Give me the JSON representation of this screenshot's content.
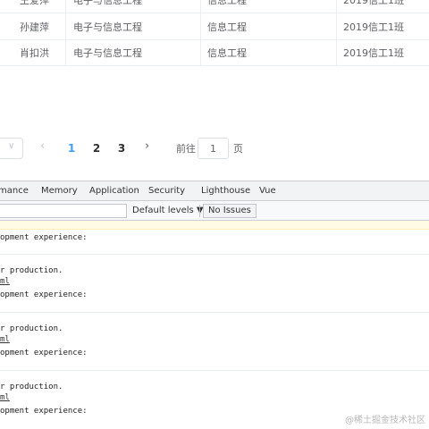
{
  "table": {
    "rows": [
      {
        "name": "王爱萍",
        "major": "电子与信息工程",
        "dept": "信息工程",
        "class": "2019信工1班"
      },
      {
        "name": "孙建萍",
        "major": "电子与信息工程",
        "dept": "信息工程",
        "class": "2019信工1班"
      },
      {
        "name": "肖扣洪",
        "major": "电子与信息工程",
        "dept": "信息工程",
        "class": "2019信工1班"
      }
    ]
  },
  "pagination": {
    "prev_icon": "chevron-left-icon",
    "next_icon": "chevron-right-icon",
    "pages": [
      "1",
      "2",
      "3"
    ],
    "current_page": "1",
    "goto_label": "前往",
    "goto_value": "1",
    "goto_suffix": "页"
  },
  "devtools": {
    "tabs": [
      "mance",
      "Memory",
      "Application",
      "Security",
      "Lighthouse",
      "Vue"
    ],
    "levels_label": "Default levels ▼",
    "issues_label": "No Issues",
    "messages": [
      {
        "lines": [
          "opment experience:"
        ]
      },
      {
        "lines": [
          "r production.",
          "ml",
          "opment experience:"
        ]
      },
      {
        "lines": [
          "r production.",
          "ml",
          "opment experience:"
        ]
      },
      {
        "lines": [
          "r production.",
          "ml",
          "opment experience:"
        ]
      }
    ]
  },
  "watermark": "@稀土掘金技术社区"
}
